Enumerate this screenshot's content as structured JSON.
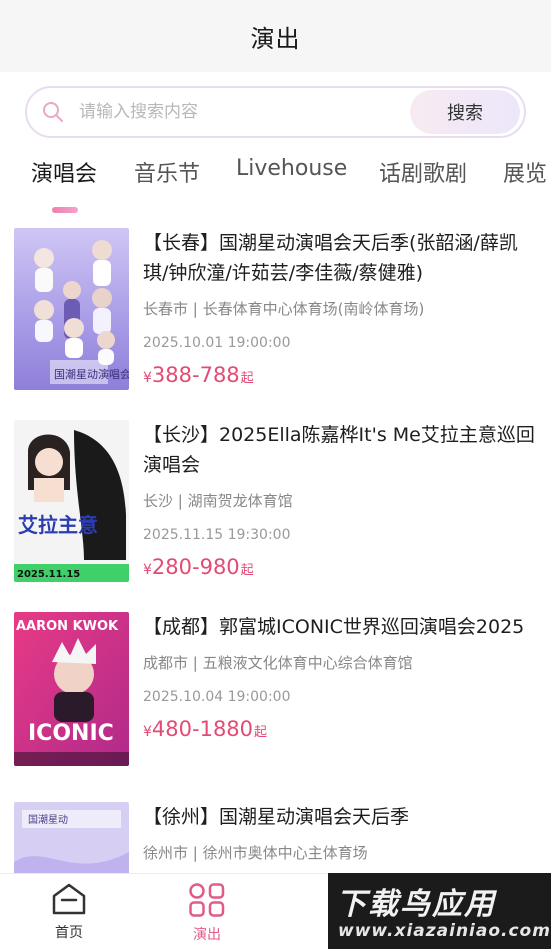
{
  "header": {
    "title": "演出"
  },
  "search": {
    "placeholder": "请输入搜索内容",
    "button_label": "搜索"
  },
  "tabs": [
    {
      "label": "演唱会",
      "active": true
    },
    {
      "label": "音乐节",
      "active": false
    },
    {
      "label": "Livehouse",
      "active": false
    },
    {
      "label": "话剧歌剧",
      "active": false
    },
    {
      "label": "展览",
      "active": false
    }
  ],
  "events": [
    {
      "title": "【长春】国潮星动演唱会天后季(张韶涵/薛凯琪/钟欣潼/许茹芸/李佳薇/蔡健雅)",
      "venue": "长春市 | 长春体育中心体育场(南岭体育场)",
      "time": "2025.10.01 19:00:00",
      "currency": "¥",
      "price": "388-788",
      "price_suffix": "起",
      "poster_text": "国潮星动演唱会"
    },
    {
      "title": "【长沙】2025Ella陈嘉桦It's Me艾拉主意巡回演唱会",
      "venue": "长沙 | 湖南贺龙体育馆",
      "time": "2025.11.15 19:30:00",
      "currency": "¥",
      "price": "280-980",
      "price_suffix": "起",
      "poster_text": "艾拉主意",
      "poster_date": "2025.11.15"
    },
    {
      "title": "【成都】郭富城ICONIC世界巡回演唱会2025",
      "venue": "成都市 | 五粮液文化体育中心综合体育馆",
      "time": "2025.10.04 19:00:00",
      "currency": "¥",
      "price": "480-1880",
      "price_suffix": "起",
      "poster_text": "AARON KWOK",
      "poster_sub": "ICONIC"
    },
    {
      "title": "【徐州】国潮星动演唱会天后季",
      "venue": "徐州市 | 徐州市奥体中心主体育场",
      "time": "",
      "currency": "¥",
      "price": "",
      "price_suffix": "",
      "poster_text": "国潮星动"
    }
  ],
  "bottom_nav": [
    {
      "label": "首页",
      "icon": "home-icon",
      "active": false
    },
    {
      "label": "演出",
      "icon": "grid-icon",
      "active": true
    }
  ],
  "watermark": {
    "main": "下载鸟应用",
    "sub": "www.xiazainiao.com"
  },
  "colors": {
    "accent": "#e44b74",
    "tab_indicator": "#ee7fb0",
    "header_bg": "#f6f6f6"
  }
}
